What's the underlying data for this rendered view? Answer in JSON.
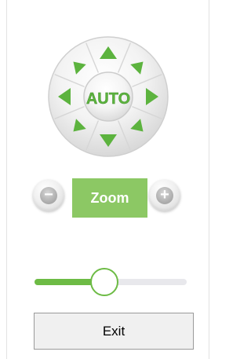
{
  "ptz": {
    "auto_label": "AUTO",
    "arrows": [
      "up",
      "up-right",
      "right",
      "down-right",
      "down",
      "down-left",
      "left",
      "up-left"
    ]
  },
  "zoom": {
    "label": "Zoom",
    "minus": "−",
    "plus": "+"
  },
  "slider": {
    "level_percent": 46
  },
  "exit": {
    "label": "Exit"
  },
  "colors": {
    "accent_green": "#6dbb45",
    "zoom_green": "#8cc864",
    "arrow_green": "#5cb33e",
    "track_gray": "#e8e8ec"
  }
}
